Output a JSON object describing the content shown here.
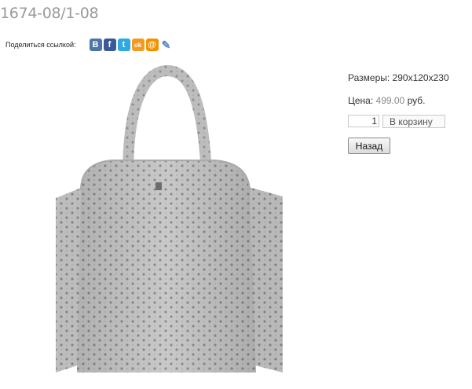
{
  "product": {
    "code": "1674-08/1-08",
    "size_label": "Размеры:",
    "size_value": "290x120x230",
    "price_label": "Цена:",
    "price_value": "499.00",
    "currency": "руб."
  },
  "share": {
    "label": "Поделиться ссылкой:",
    "icons": [
      {
        "name": "vkontakte-icon",
        "glyph": "B",
        "color": "#4a76a8"
      },
      {
        "name": "facebook-icon",
        "glyph": "f",
        "color": "#3b5998"
      },
      {
        "name": "twitter-icon",
        "glyph": "t",
        "color": "#2daae1"
      },
      {
        "name": "odnoklassniki-icon",
        "glyph": "ok",
        "color": "#f59a1f"
      },
      {
        "name": "mailru-icon",
        "glyph": "@",
        "color": "#f29400"
      },
      {
        "name": "livejournal-icon",
        "glyph": "✎",
        "color": "#5a88c4"
      }
    ]
  },
  "cart": {
    "quantity": "1",
    "add_label": "В корзину",
    "back_label": "Назад"
  }
}
